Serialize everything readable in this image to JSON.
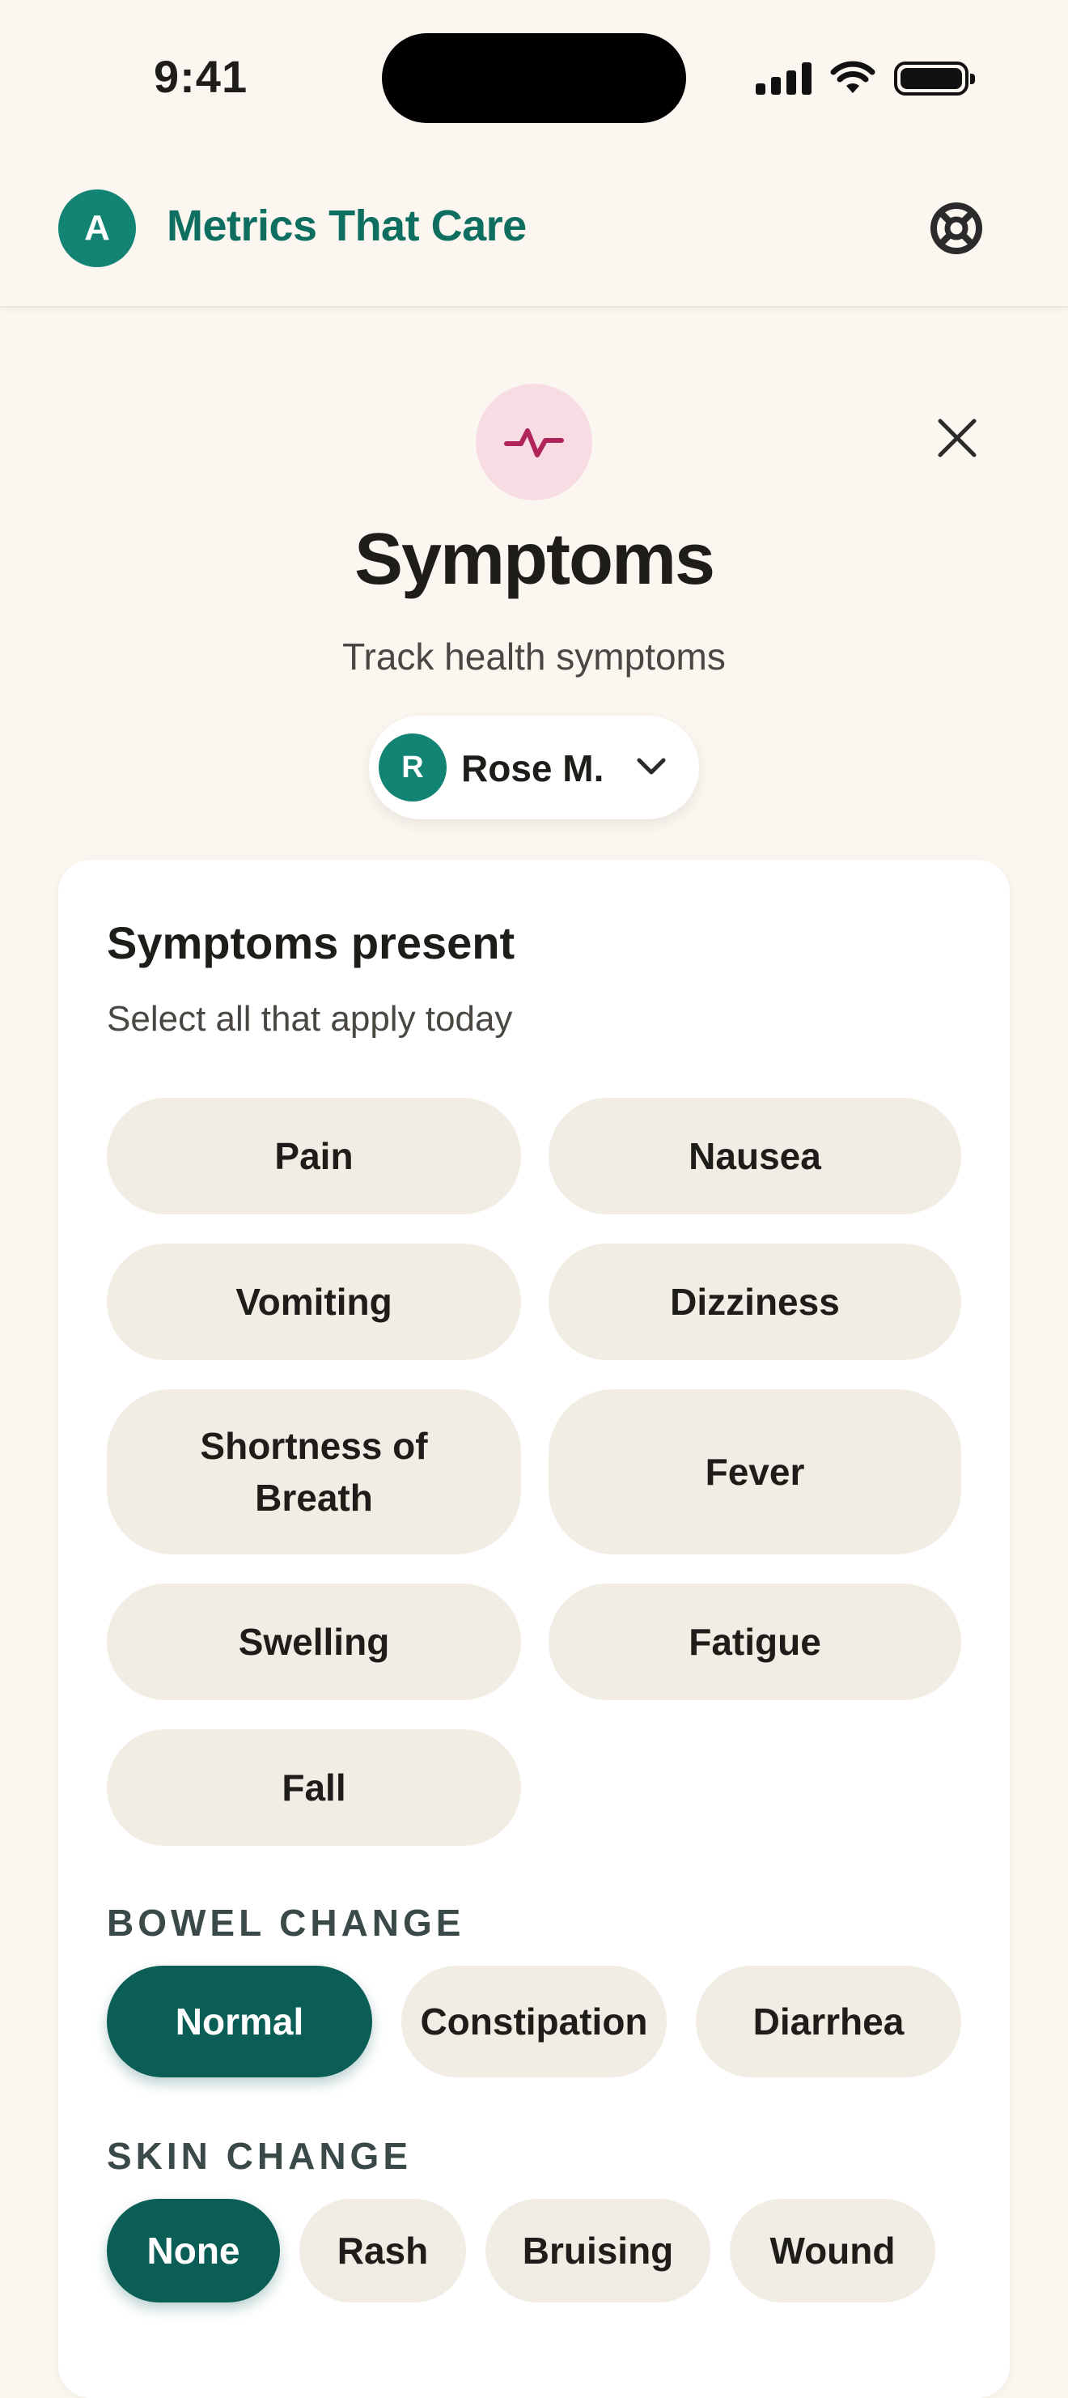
{
  "status": {
    "time": "9:41"
  },
  "header": {
    "avatar_initial": "A",
    "app_name": "Metrics That Care"
  },
  "modal": {
    "title": "Symptoms",
    "subtitle": "Track health symptoms",
    "person": {
      "initial": "R",
      "name": "Rose M."
    }
  },
  "card": {
    "title": "Symptoms present",
    "subtitle": "Select all that apply today",
    "symptoms": [
      "Pain",
      "Nausea",
      "Vomiting",
      "Dizziness",
      "Shortness of Breath",
      "Fever",
      "Swelling",
      "Fatigue",
      "Fall"
    ],
    "bowel": {
      "label": "BOWEL CHANGE",
      "options": [
        "Normal",
        "Constipation",
        "Diarrhea"
      ],
      "selected": "Normal"
    },
    "skin": {
      "label": "SKIN CHANGE",
      "options": [
        "None",
        "Rash",
        "Bruising",
        "Wound"
      ],
      "selected": "None"
    }
  },
  "colors": {
    "accent": "#0B5E55",
    "brand": "#0E6F61",
    "avatar": "#138474",
    "icon_bg": "#F8DCE4",
    "icon_stroke": "#B0245A",
    "chip_bg": "#F1ECE4"
  },
  "icons": {
    "help": "lifebuoy-icon",
    "close": "close-icon",
    "modal": "pulse-icon",
    "dropdown": "chevron-down-icon"
  }
}
